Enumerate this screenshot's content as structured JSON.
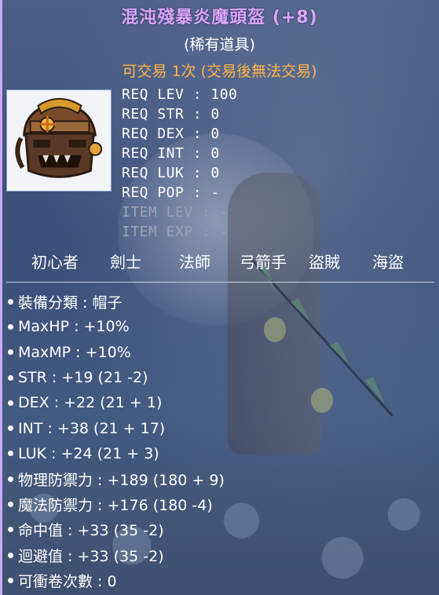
{
  "item": {
    "name": "混沌殘暴炎魔頭盔 (+8)",
    "rarity": "(稀有道具)",
    "trade_note": "可交易 1次 (交易後無法交易)",
    "icon": "helmet-icon"
  },
  "requirements": [
    {
      "label": "REQ LEV : 100",
      "enabled": true
    },
    {
      "label": "REQ STR : 0",
      "enabled": true
    },
    {
      "label": "REQ DEX : 0",
      "enabled": true
    },
    {
      "label": "REQ INT : 0",
      "enabled": true
    },
    {
      "label": "REQ LUK : 0",
      "enabled": true
    },
    {
      "label": "REQ POP : -",
      "enabled": true
    },
    {
      "label": "ITEM LEV : -",
      "enabled": false
    },
    {
      "label": "ITEM EXP : -",
      "enabled": false
    }
  ],
  "jobs": [
    "初心者",
    "劍士",
    "法師",
    "弓箭手",
    "盜賊",
    "海盜"
  ],
  "stats": [
    "裝備分類 : 帽子",
    "MaxHP : +10%",
    "MaxMP : +10%",
    "STR : +19 (21 -2)",
    "DEX : +22 (21 + 1)",
    "INT : +38 (21 + 17)",
    "LUK : +24 (21 + 3)",
    "物理防禦力 : +189 (180 + 9)",
    "魔法防禦力 : +176 (180 -4)",
    "命中值 : +33 (35 -2)",
    "迴避值 : +33 (35 -2)",
    "可衝卷次數 : 0"
  ],
  "colors": {
    "title": "#d9a6ff",
    "trade": "#ffb347",
    "text": "#ffffff",
    "disabled": "#9aa4b8"
  }
}
